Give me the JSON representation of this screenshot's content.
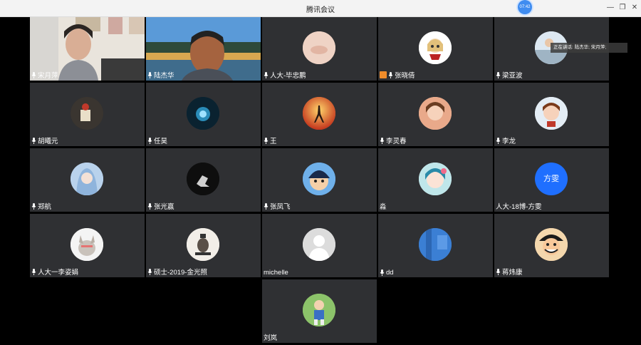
{
  "window": {
    "title": "腾讯会议",
    "timer": "07:42"
  },
  "speaking": "正在讲话: 陆杰华; 宋月萍;",
  "participants": [
    {
      "name": "宋月萍",
      "mic": true
    },
    {
      "name": "陆杰华",
      "mic": true
    },
    {
      "name": "人大-毕忠鹏",
      "mic": true
    },
    {
      "name": "张晓倩",
      "mic": true,
      "badge": true
    },
    {
      "name": "梁亚波",
      "mic": true
    },
    {
      "name": "胡曦元",
      "mic": true
    },
    {
      "name": "任昊",
      "mic": true
    },
    {
      "name": "王",
      "mic": true
    },
    {
      "name": "李灵春",
      "mic": true
    },
    {
      "name": "李龙",
      "mic": true
    },
    {
      "name": "郑航",
      "mic": true
    },
    {
      "name": "张光赢",
      "mic": true
    },
    {
      "name": "张凤飞",
      "mic": true
    },
    {
      "name": "淼",
      "mic": false
    },
    {
      "name": "人大-18博-方雯",
      "mic": false
    },
    {
      "name": "人大一李姿娟",
      "mic": true
    },
    {
      "name": "硕士-2019-金光照",
      "mic": true
    },
    {
      "name": "michelle",
      "mic": false
    },
    {
      "name": "dd",
      "mic": true
    },
    {
      "name": "蒋炜康",
      "mic": true
    },
    {
      "name": "刘岚",
      "mic": false
    }
  ],
  "avatar_text": {
    "fangwen": "方雯"
  },
  "colors": {
    "tile_bg": "#2f3033",
    "accent": "#1f6fff",
    "active_border": "#3fb870"
  },
  "icons": {
    "mic": "microphone-icon",
    "minimize": "minimize-icon",
    "restore": "restore-icon",
    "close": "close-icon"
  }
}
